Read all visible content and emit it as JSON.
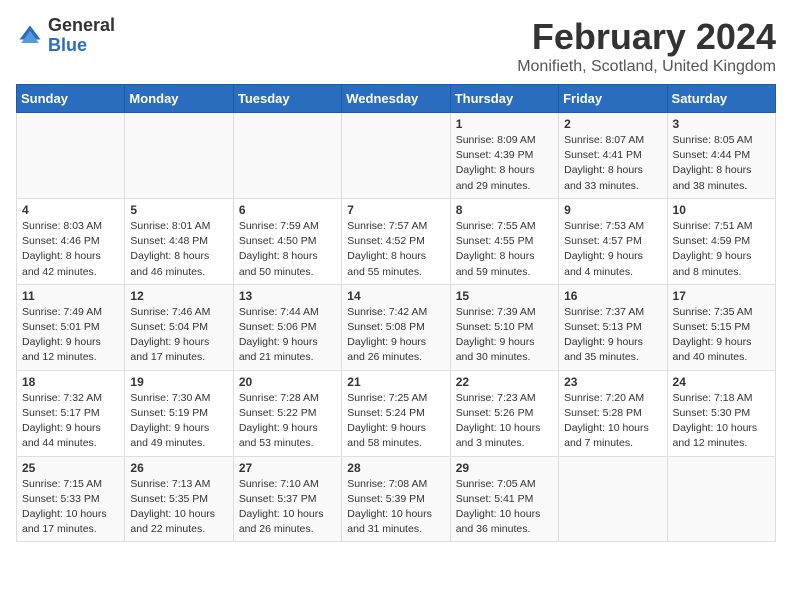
{
  "header": {
    "logo_general": "General",
    "logo_blue": "Blue",
    "title": "February 2024",
    "subtitle": "Monifieth, Scotland, United Kingdom"
  },
  "calendar": {
    "days_of_week": [
      "Sunday",
      "Monday",
      "Tuesday",
      "Wednesday",
      "Thursday",
      "Friday",
      "Saturday"
    ],
    "weeks": [
      [
        {
          "day": "",
          "text": ""
        },
        {
          "day": "",
          "text": ""
        },
        {
          "day": "",
          "text": ""
        },
        {
          "day": "",
          "text": ""
        },
        {
          "day": "1",
          "text": "Sunrise: 8:09 AM\nSunset: 4:39 PM\nDaylight: 8 hours\nand 29 minutes."
        },
        {
          "day": "2",
          "text": "Sunrise: 8:07 AM\nSunset: 4:41 PM\nDaylight: 8 hours\nand 33 minutes."
        },
        {
          "day": "3",
          "text": "Sunrise: 8:05 AM\nSunset: 4:44 PM\nDaylight: 8 hours\nand 38 minutes."
        }
      ],
      [
        {
          "day": "4",
          "text": "Sunrise: 8:03 AM\nSunset: 4:46 PM\nDaylight: 8 hours\nand 42 minutes."
        },
        {
          "day": "5",
          "text": "Sunrise: 8:01 AM\nSunset: 4:48 PM\nDaylight: 8 hours\nand 46 minutes."
        },
        {
          "day": "6",
          "text": "Sunrise: 7:59 AM\nSunset: 4:50 PM\nDaylight: 8 hours\nand 50 minutes."
        },
        {
          "day": "7",
          "text": "Sunrise: 7:57 AM\nSunset: 4:52 PM\nDaylight: 8 hours\nand 55 minutes."
        },
        {
          "day": "8",
          "text": "Sunrise: 7:55 AM\nSunset: 4:55 PM\nDaylight: 8 hours\nand 59 minutes."
        },
        {
          "day": "9",
          "text": "Sunrise: 7:53 AM\nSunset: 4:57 PM\nDaylight: 9 hours\nand 4 minutes."
        },
        {
          "day": "10",
          "text": "Sunrise: 7:51 AM\nSunset: 4:59 PM\nDaylight: 9 hours\nand 8 minutes."
        }
      ],
      [
        {
          "day": "11",
          "text": "Sunrise: 7:49 AM\nSunset: 5:01 PM\nDaylight: 9 hours\nand 12 minutes."
        },
        {
          "day": "12",
          "text": "Sunrise: 7:46 AM\nSunset: 5:04 PM\nDaylight: 9 hours\nand 17 minutes."
        },
        {
          "day": "13",
          "text": "Sunrise: 7:44 AM\nSunset: 5:06 PM\nDaylight: 9 hours\nand 21 minutes."
        },
        {
          "day": "14",
          "text": "Sunrise: 7:42 AM\nSunset: 5:08 PM\nDaylight: 9 hours\nand 26 minutes."
        },
        {
          "day": "15",
          "text": "Sunrise: 7:39 AM\nSunset: 5:10 PM\nDaylight: 9 hours\nand 30 minutes."
        },
        {
          "day": "16",
          "text": "Sunrise: 7:37 AM\nSunset: 5:13 PM\nDaylight: 9 hours\nand 35 minutes."
        },
        {
          "day": "17",
          "text": "Sunrise: 7:35 AM\nSunset: 5:15 PM\nDaylight: 9 hours\nand 40 minutes."
        }
      ],
      [
        {
          "day": "18",
          "text": "Sunrise: 7:32 AM\nSunset: 5:17 PM\nDaylight: 9 hours\nand 44 minutes."
        },
        {
          "day": "19",
          "text": "Sunrise: 7:30 AM\nSunset: 5:19 PM\nDaylight: 9 hours\nand 49 minutes."
        },
        {
          "day": "20",
          "text": "Sunrise: 7:28 AM\nSunset: 5:22 PM\nDaylight: 9 hours\nand 53 minutes."
        },
        {
          "day": "21",
          "text": "Sunrise: 7:25 AM\nSunset: 5:24 PM\nDaylight: 9 hours\nand 58 minutes."
        },
        {
          "day": "22",
          "text": "Sunrise: 7:23 AM\nSunset: 5:26 PM\nDaylight: 10 hours\nand 3 minutes."
        },
        {
          "day": "23",
          "text": "Sunrise: 7:20 AM\nSunset: 5:28 PM\nDaylight: 10 hours\nand 7 minutes."
        },
        {
          "day": "24",
          "text": "Sunrise: 7:18 AM\nSunset: 5:30 PM\nDaylight: 10 hours\nand 12 minutes."
        }
      ],
      [
        {
          "day": "25",
          "text": "Sunrise: 7:15 AM\nSunset: 5:33 PM\nDaylight: 10 hours\nand 17 minutes."
        },
        {
          "day": "26",
          "text": "Sunrise: 7:13 AM\nSunset: 5:35 PM\nDaylight: 10 hours\nand 22 minutes."
        },
        {
          "day": "27",
          "text": "Sunrise: 7:10 AM\nSunset: 5:37 PM\nDaylight: 10 hours\nand 26 minutes."
        },
        {
          "day": "28",
          "text": "Sunrise: 7:08 AM\nSunset: 5:39 PM\nDaylight: 10 hours\nand 31 minutes."
        },
        {
          "day": "29",
          "text": "Sunrise: 7:05 AM\nSunset: 5:41 PM\nDaylight: 10 hours\nand 36 minutes."
        },
        {
          "day": "",
          "text": ""
        },
        {
          "day": "",
          "text": ""
        }
      ]
    ]
  }
}
